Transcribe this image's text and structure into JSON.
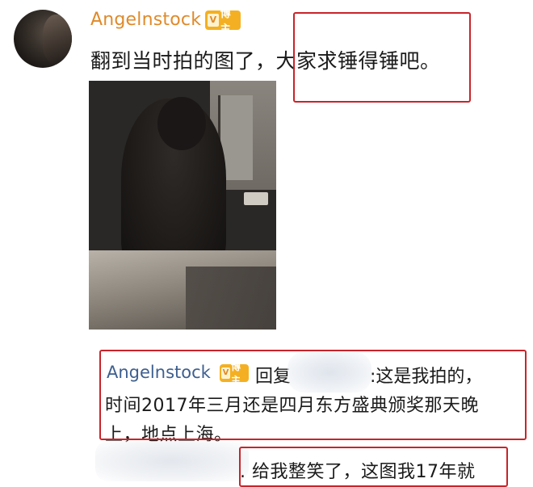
{
  "post": {
    "username": "Angelnstock",
    "badge_label": "博主",
    "badge_icon": "V",
    "text_part1": "翻到当时拍的图了，",
    "text_part2": "大家求锤得锤吧。"
  },
  "reply": {
    "username": "Angelnstock",
    "badge_label": "博主",
    "badge_icon": "V",
    "prefix": "回复",
    "line1_rest": ":这是我拍的，",
    "line2": "时间2017年三月还是四月东方盛典颁奖那天晚",
    "line3": "上，地点上海。"
  },
  "reply2": {
    "text": ". 给我整笑了，这图我17年就"
  },
  "colors": {
    "username_orange": "#e08a2a",
    "reply_username_blue": "#3d5f8f",
    "highlight_red": "#c8242a",
    "badge_gold": "#f4b022"
  }
}
